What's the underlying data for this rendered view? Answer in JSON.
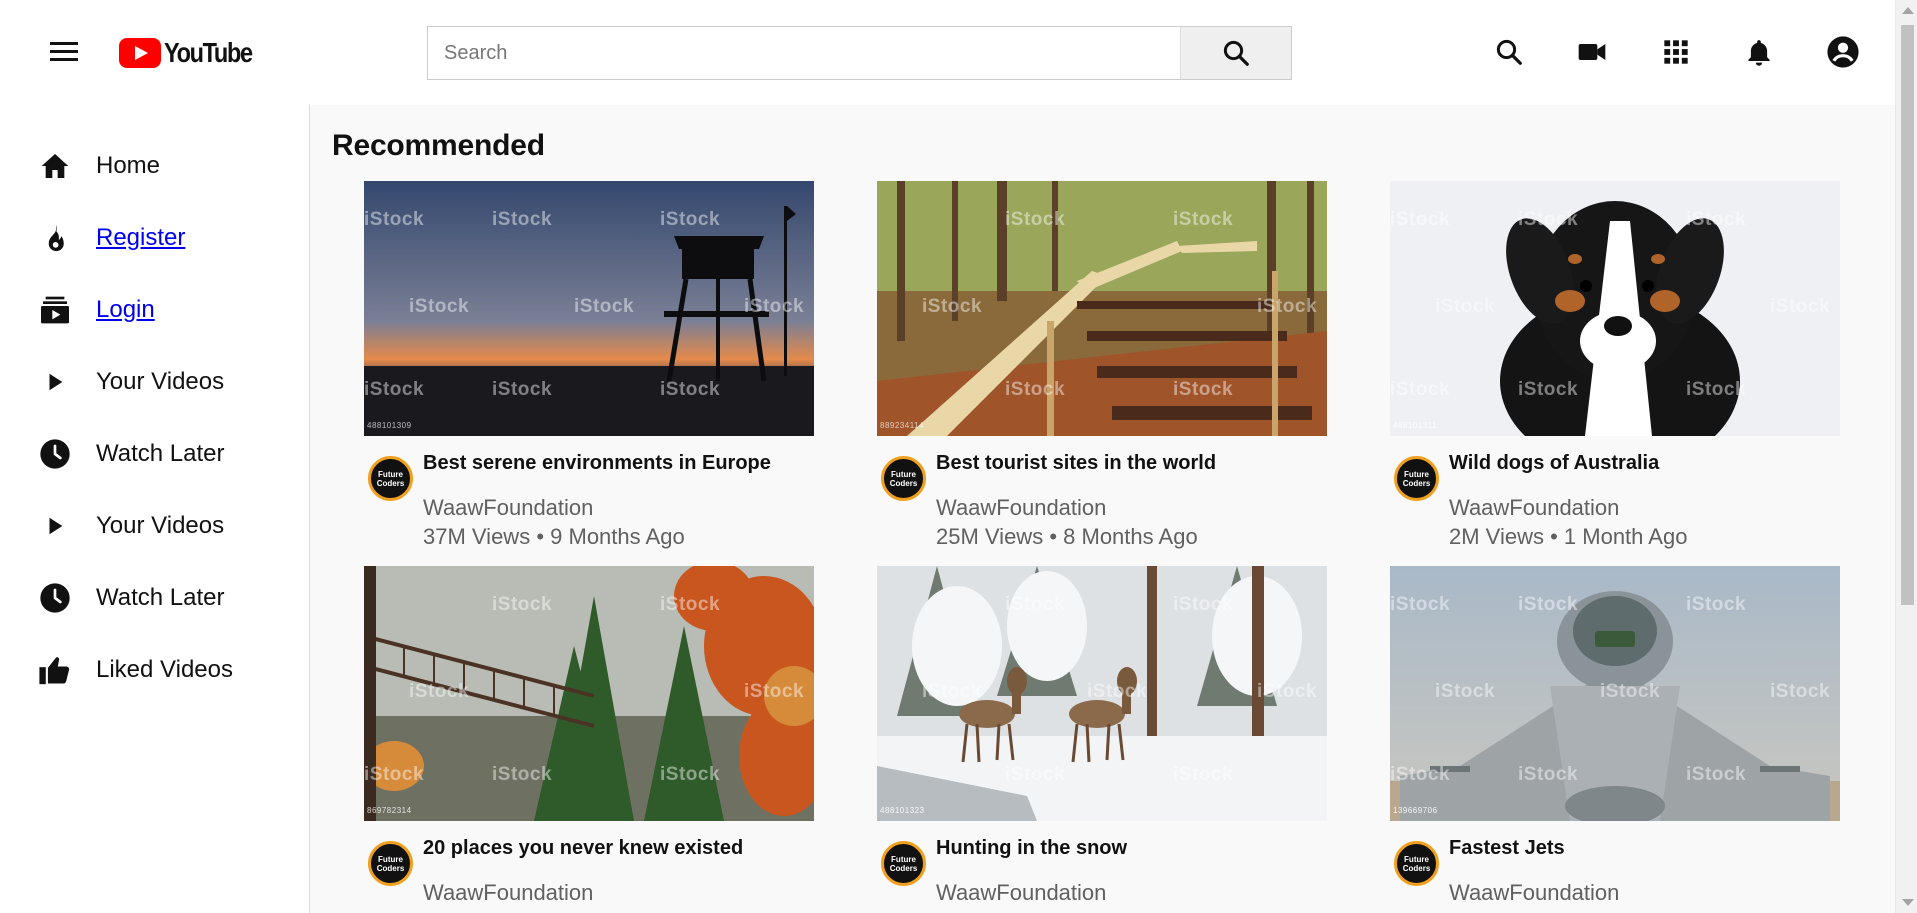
{
  "header": {
    "logo_text": "YouTube",
    "search_placeholder": "Search",
    "icons": [
      "menu-icon",
      "search-icon",
      "video-camera-icon",
      "apps-grid-icon",
      "bell-icon",
      "account-icon"
    ]
  },
  "sidebar": {
    "items": [
      {
        "label": "Home",
        "icon": "home-icon",
        "link": false
      },
      {
        "label": "Register",
        "icon": "fire-icon",
        "link": true
      },
      {
        "label": "Login",
        "icon": "subscriptions-icon",
        "link": true
      },
      {
        "label": "Your Videos",
        "icon": "play-icon",
        "link": false
      },
      {
        "label": "Watch Later",
        "icon": "clock-icon",
        "link": false
      },
      {
        "label": "Your Videos",
        "icon": "play-icon",
        "link": false
      },
      {
        "label": "Watch Later",
        "icon": "clock-icon",
        "link": false
      },
      {
        "label": "Liked Videos",
        "icon": "thumbs-up-icon",
        "link": false
      }
    ]
  },
  "main": {
    "section_title": "Recommended",
    "watermark": "iStock",
    "avatar_text": "Future Coders",
    "videos": [
      {
        "title": "Best serene environments in Europe",
        "channel": "WaawFoundation",
        "views": "37M Views",
        "age": "9 Months Ago",
        "image_id": "488101309"
      },
      {
        "title": "Best tourist sites in the world",
        "channel": "WaawFoundation",
        "views": "25M Views",
        "age": "8 Months Ago",
        "image_id": "889234114"
      },
      {
        "title": "Wild dogs of Australia",
        "channel": "WaawFoundation",
        "views": "2M Views",
        "age": "1 Month Ago",
        "image_id": "488101311"
      },
      {
        "title": "20 places you never knew existed",
        "channel": "WaawFoundation",
        "views": "",
        "age": "",
        "image_id": "869782314"
      },
      {
        "title": "Hunting in the snow",
        "channel": "WaawFoundation",
        "views": "",
        "age": "",
        "image_id": "488101323"
      },
      {
        "title": "Fastest Jets",
        "channel": "WaawFoundation",
        "views": "",
        "age": "",
        "image_id": "139669706"
      }
    ]
  }
}
